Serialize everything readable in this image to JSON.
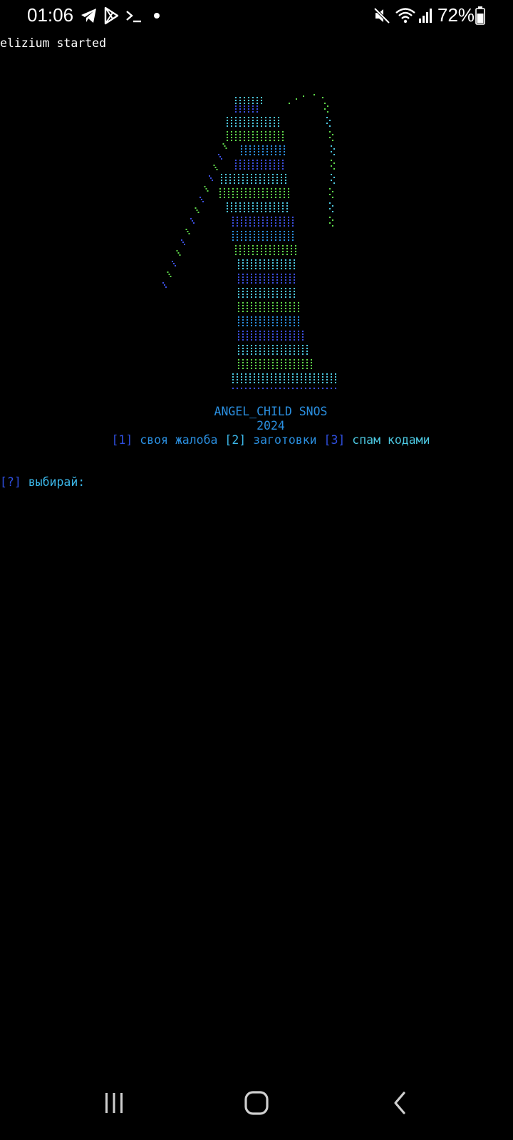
{
  "status_bar": {
    "time": "01:06",
    "battery": "72%",
    "icons": [
      "telegram-icon",
      "play-store-icon",
      "terminal-icon",
      "dot-icon",
      "mute-icon",
      "wifi-icon",
      "signal-icon",
      "battery-icon"
    ]
  },
  "terminal": {
    "started_line": "elizium started",
    "title": "ANGEL_CHILD SNOS",
    "year": "2024",
    "menu": {
      "opt1_key": "[1]",
      "opt1_label": "своя жалоба",
      "opt2_key": "[2]",
      "opt2_label": "заготовки",
      "opt3_key": "[3]",
      "opt3_label": "спам кодами"
    },
    "prompt": {
      "key": "[?]",
      "label": "выбирай:"
    },
    "ascii_art_colors": [
      "#3b4fe0",
      "#4cc7e0",
      "#5fd94a",
      "#2a8fe0"
    ]
  },
  "nav_bar": {
    "icons": [
      "recent-apps-icon",
      "home-icon",
      "back-icon"
    ]
  }
}
